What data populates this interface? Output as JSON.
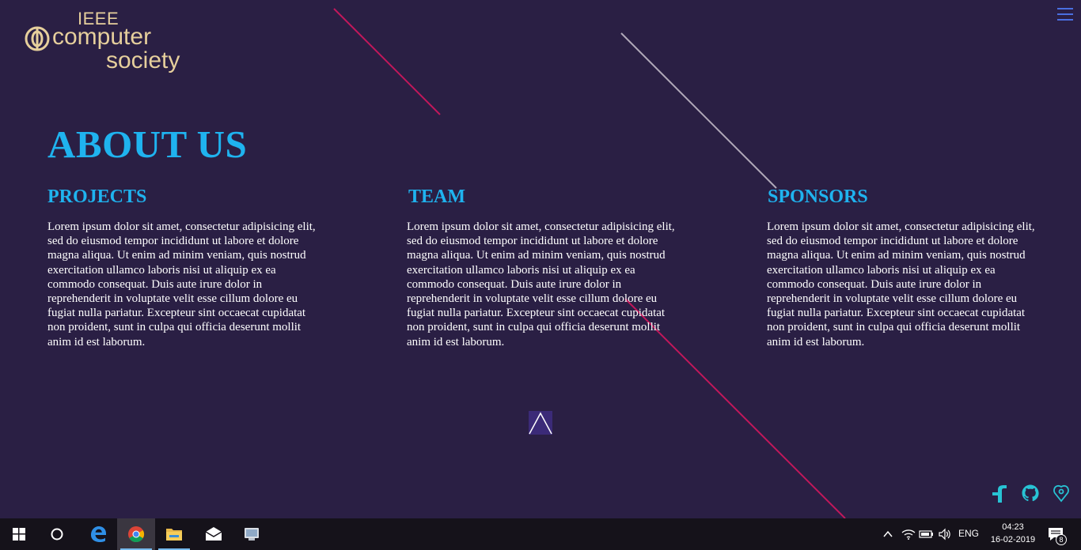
{
  "logo": {
    "line1": "IEEE",
    "line2": "computer",
    "line3": "society"
  },
  "about": {
    "title": "ABOUT US",
    "columns": [
      {
        "heading": "PROJECTS",
        "text": "Lorem ipsum dolor sit amet, consectetur adipisicing elit, sed do eiusmod tempor incididunt ut labore et dolore magna aliqua. Ut enim ad minim veniam, quis nostrud exercitation ullamco laboris nisi ut aliquip ex ea commodo consequat. Duis aute irure dolor in reprehenderit in voluptate velit esse cillum dolore eu fugiat nulla pariatur. Excepteur sint occaecat cupidatat non proident, sunt in culpa qui officia deserunt mollit anim id est laborum."
      },
      {
        "heading": "TEAM",
        "text": "Lorem ipsum dolor sit amet, consectetur adipisicing elit, sed do eiusmod tempor incididunt ut labore et dolore magna aliqua. Ut enim ad minim veniam, quis nostrud exercitation ullamco laboris nisi ut aliquip ex ea commodo consequat. Duis aute irure dolor in reprehenderit in voluptate velit esse cillum dolore eu fugiat nulla pariatur. Excepteur sint occaecat cupidatat non proident, sunt in culpa qui officia deserunt mollit anim id est laborum."
      },
      {
        "heading": "SPONSORS",
        "text": "Lorem ipsum dolor sit amet, consectetur adipisicing elit, sed do eiusmod tempor incididunt ut labore et dolore magna aliqua. Ut enim ad minim veniam, quis nostrud exercitation ullamco laboris nisi ut aliquip ex ea commodo consequat. Duis aute irure dolor in reprehenderit in voluptate velit esse cillum dolore eu fugiat nulla pariatur. Excepteur sint occaecat cupidatat non proident, sunt in culpa qui officia deserunt mollit anim id est laborum."
      }
    ]
  },
  "icons": {
    "menu": "hamburger-menu-icon",
    "scroll_up": "chevron-up-icon",
    "social": [
      "facebook-icon",
      "github-icon",
      "location-icon"
    ]
  },
  "colors": {
    "background": "#2a1f44",
    "accent": "#1fb3ef",
    "logo": "#e6cf9c",
    "decor_line_red": "#c2185b",
    "decor_line_grey": "#b0a8b8",
    "social": "#28c3d4"
  },
  "taskbar": {
    "apps": [
      "windows-start-icon",
      "cortana-icon",
      "edge-icon",
      "chrome-icon",
      "file-explorer-icon",
      "mail-icon",
      "app-icon"
    ],
    "language": "ENG",
    "time": "04:23",
    "date": "16-02-2019",
    "notification_count": "8"
  }
}
